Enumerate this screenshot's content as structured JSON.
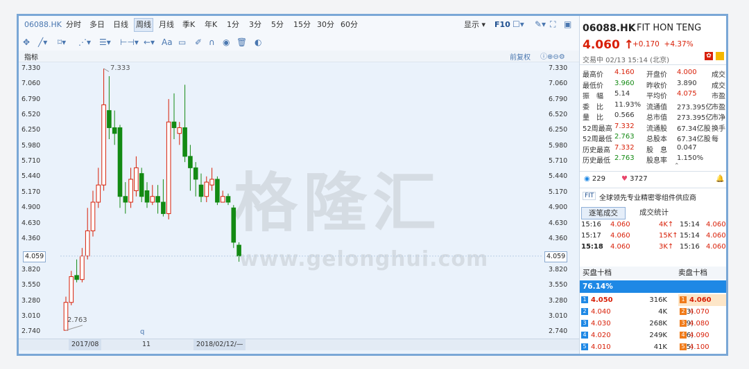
{
  "toolbar": {
    "code": "06088.HK",
    "periods": [
      "分时",
      "多日",
      "日线",
      "周线",
      "月线",
      "季K",
      "年K",
      "1分",
      "3分",
      "5分",
      "15分",
      "30分",
      "60分"
    ],
    "active_period": "周线",
    "display_label": "显示",
    "f10_label": "F10"
  },
  "indicator_label": "指标",
  "adjust_label": "前复权",
  "axis": {
    "left": [
      "7.330",
      "7.060",
      "6.790",
      "6.520",
      "6.250",
      "5.980",
      "5.710",
      "5.440",
      "5.170",
      "4.900",
      "4.630",
      "4.360",
      "4.059",
      "3.820",
      "3.550",
      "3.280",
      "3.010",
      "2.740"
    ],
    "right": [
      "7.330",
      "7.060",
      "6.790",
      "6.520",
      "6.250",
      "5.980",
      "5.710",
      "5.440",
      "5.170",
      "4.900",
      "4.630",
      "4.360",
      "4.059",
      "3.820",
      "3.550",
      "3.280",
      "3.010",
      "2.740"
    ]
  },
  "annotations": {
    "high": "7.333",
    "low": "2.763"
  },
  "x_labels": {
    "a": "2017/08",
    "b": "11",
    "c": "2018/02/12/—"
  },
  "watermark": {
    "cn": "格隆汇",
    "en": "www.gelonghui.com"
  },
  "stock": {
    "code": "06088.HK",
    "name": "FIT HON TENG",
    "price": "4.060",
    "change": "+0.170",
    "change_pct": "+4.37%",
    "time": "交易中 02/13 15:14 (北京)"
  },
  "quotes": [
    {
      "l1": "最高价",
      "v1": "4.160",
      "c1": "red",
      "l2": "开盘价",
      "v2": "4.000",
      "c2": "red",
      "l3": "成交"
    },
    {
      "l1": "最低价",
      "v1": "3.960",
      "c1": "green",
      "l2": "昨收价",
      "v2": "3.890",
      "c2": "",
      "l3": "成交"
    },
    {
      "l1": "振　幅",
      "v1": "5.14",
      "c1": "",
      "l2": "平均价",
      "v2": "4.075",
      "c2": "red",
      "l3": "市盈"
    },
    {
      "l1": "委　比",
      "v1": "11.93%",
      "c1": "",
      "l2": "流通值",
      "v2": "273.395亿",
      "c2": "",
      "l3": "市盈"
    },
    {
      "l1": "量　比",
      "v1": "0.566",
      "c1": "",
      "l2": "总市值",
      "v2": "273.395亿",
      "c2": "",
      "l3": "市净"
    },
    {
      "l1": "52周最高",
      "v1": "7.332",
      "c1": "red",
      "l2": "流通股",
      "v2": "67.34亿股",
      "c2": "",
      "l3": "换手"
    },
    {
      "l1": "52周最低",
      "v1": "2.763",
      "c1": "green",
      "l2": "总股本",
      "v2": "67.34亿股",
      "c2": "",
      "l3": "每"
    },
    {
      "l1": "历史最高",
      "v1": "7.332",
      "c1": "red",
      "l2": "股　息",
      "v2": "0.047",
      "c2": "",
      "l3": ""
    },
    {
      "l1": "历史最低",
      "v1": "2.763",
      "c1": "green",
      "l2": "股息率",
      "v2": "1.150%",
      "c2": "",
      "l3": ""
    }
  ],
  "social": {
    "views": "229",
    "likes": "3727"
  },
  "desc": "全球领先专业精密零组件供应商",
  "tabs": [
    "逐笔成交",
    "成交统计"
  ],
  "trades": [
    {
      "t1": "15:16",
      "p1": "4.060",
      "v": "4K",
      "t2": "15:14",
      "p2": "4.060"
    },
    {
      "t1": "15:17",
      "p1": "4.060",
      "v": "15K",
      "t2": "15:14",
      "p2": "4.060"
    },
    {
      "t1": "15:18",
      "p1": "4.060",
      "v": "3K",
      "t2": "15:16",
      "p2": "4.060"
    }
  ],
  "book": {
    "buy_title": "买盘十档",
    "sell_title": "卖盘十档",
    "ratio": "76.14%",
    "rows": [
      {
        "n": "1",
        "bp": "4.050",
        "bv": "316K",
        "bc": "31",
        "sn": "1",
        "sp": "4.060"
      },
      {
        "n": "2",
        "bp": "4.040",
        "bv": "4K",
        "bc": "3",
        "sn": "2",
        "sp": "4.070"
      },
      {
        "n": "3",
        "bp": "4.030",
        "bv": "268K",
        "bc": "9",
        "sn": "3",
        "sp": "4.080"
      },
      {
        "n": "4",
        "bp": "4.020",
        "bv": "249K",
        "bc": "6",
        "sn": "4",
        "sp": "4.090"
      },
      {
        "n": "5",
        "bp": "4.010",
        "bv": "41K",
        "bc": "5",
        "sn": "5",
        "sp": "4.100"
      }
    ]
  }
}
